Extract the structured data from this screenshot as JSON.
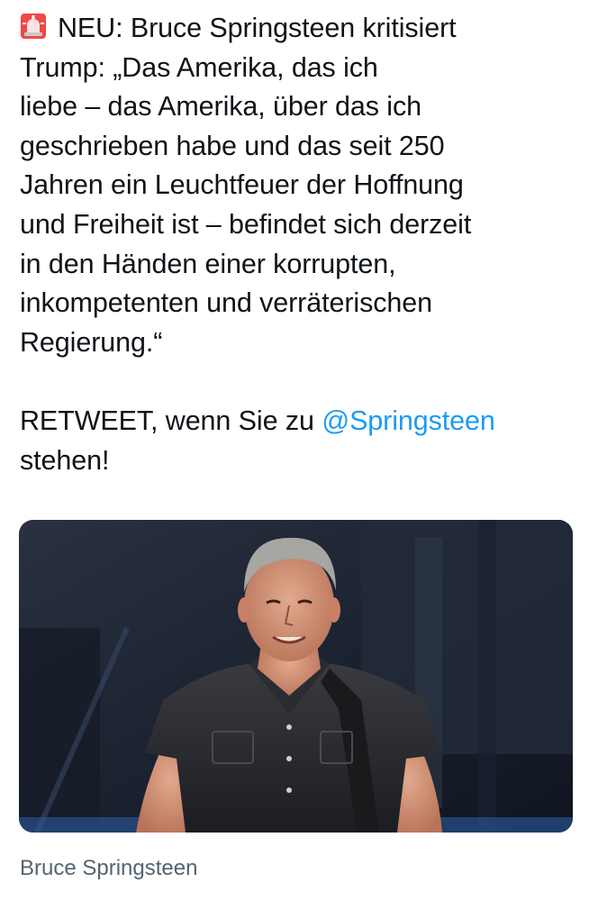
{
  "tweet": {
    "lines": [
      "NEU: Bruce Springsteen kritisiert",
      "Trump: „Das Amerika, das ich",
      "liebe – das Amerika, über das ich",
      "geschrieben habe und das seit 250",
      "Jahren ein Leuchtfeuer der Hoffnung",
      "und Freiheit ist – befindet sich derzeit",
      "in den Händen einer korrupten,",
      "inkompetenten und verräterischen",
      "Regierung.“"
    ],
    "retweet_prefix": "RETWEET, wenn Sie zu ",
    "mention": "@Springsteen",
    "retweet_suffix": "stehen!",
    "emoji": "police-car-light-icon"
  },
  "media": {
    "caption": "Bruce Springsteen"
  },
  "colors": {
    "text": "#0f1419",
    "mention": "#1d9bf0",
    "caption": "#536471"
  }
}
